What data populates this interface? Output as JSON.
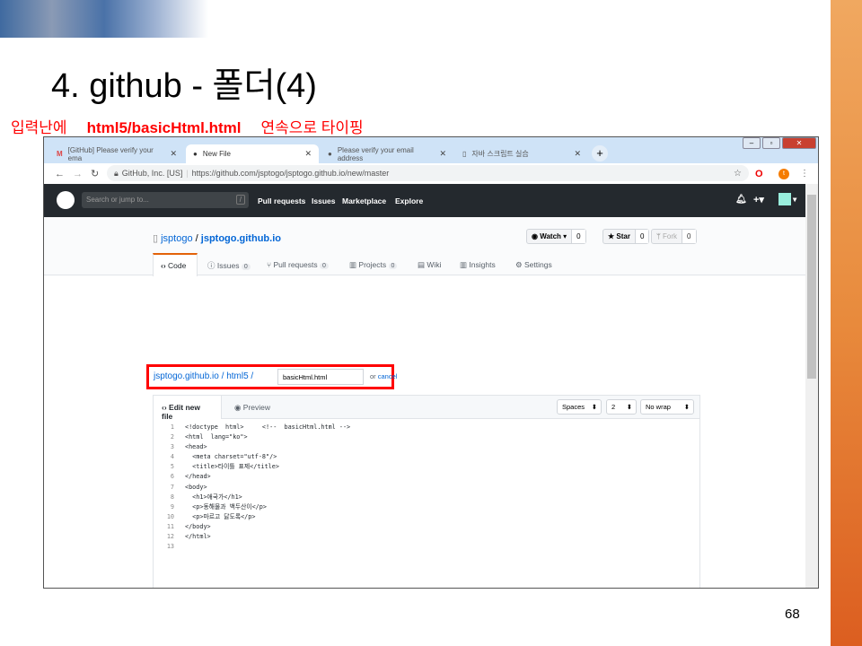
{
  "slide": {
    "title": "4. github - 폴더(4)",
    "instruction_pre": "입력난에",
    "instruction_path": "html5/basicHtml.html",
    "instruction_post": "연속으로 타이핑",
    "page_number": "68"
  },
  "browser": {
    "tabs": [
      {
        "label": "[GitHub] Please verify your ema",
        "icon": "gmail-icon"
      },
      {
        "label": "New File",
        "icon": "github-icon",
        "active": true
      },
      {
        "label": "Please verify your email address",
        "icon": "github-icon"
      },
      {
        "label": "자바 스크립트 실습",
        "icon": "page-icon"
      }
    ],
    "site_identity": "GitHub, Inc. [US]",
    "url": "https://github.com/jsptogo/jsptogo.github.io/new/master",
    "profile_initial": "t"
  },
  "github": {
    "search_placeholder": "Search or jump to...",
    "search_key": "/",
    "nav": [
      "Pull requests",
      "Issues",
      "Marketplace",
      "Explore"
    ],
    "owner": "jsptogo",
    "repo": "jsptogo.github.io",
    "watch": "Watch",
    "watch_count": "0",
    "star": "Star",
    "star_count": "0",
    "fork": "Fork",
    "fork_count": "0",
    "tabs": [
      {
        "label": "Code"
      },
      {
        "label": "Issues",
        "count": "0"
      },
      {
        "label": "Pull requests",
        "count": "0"
      },
      {
        "label": "Projects",
        "count": "0"
      },
      {
        "label": "Wiki"
      },
      {
        "label": "Insights"
      },
      {
        "label": "Settings"
      }
    ],
    "path_repo": "jsptogo.github.io",
    "path_folder": "html5",
    "filename": "basicHtml.html",
    "or": "or",
    "cancel": "cancel",
    "edit_tab": "Edit new file",
    "preview_tab": "Preview",
    "indent_mode": "Spaces",
    "indent_size": "2",
    "wrap_mode": "No wrap",
    "code": [
      "<!doctype  html>     <!--  basicHtml.html -->",
      "<html  lang=\"ko\">",
      "<head>",
      "  <meta charset=\"utf-8\"/>",
      "  <title>타이틀 표제</title>",
      "</head>",
      "<body>",
      "  <h1>애국가</h1>",
      "  <p>동해물과 백두산이</p>",
      "  <p>마르고 닳도록</p>",
      "</body>",
      "</html>",
      ""
    ]
  },
  "colors": {
    "highlight": "#ff0000",
    "header": "#24292e",
    "link": "#0366d6"
  }
}
